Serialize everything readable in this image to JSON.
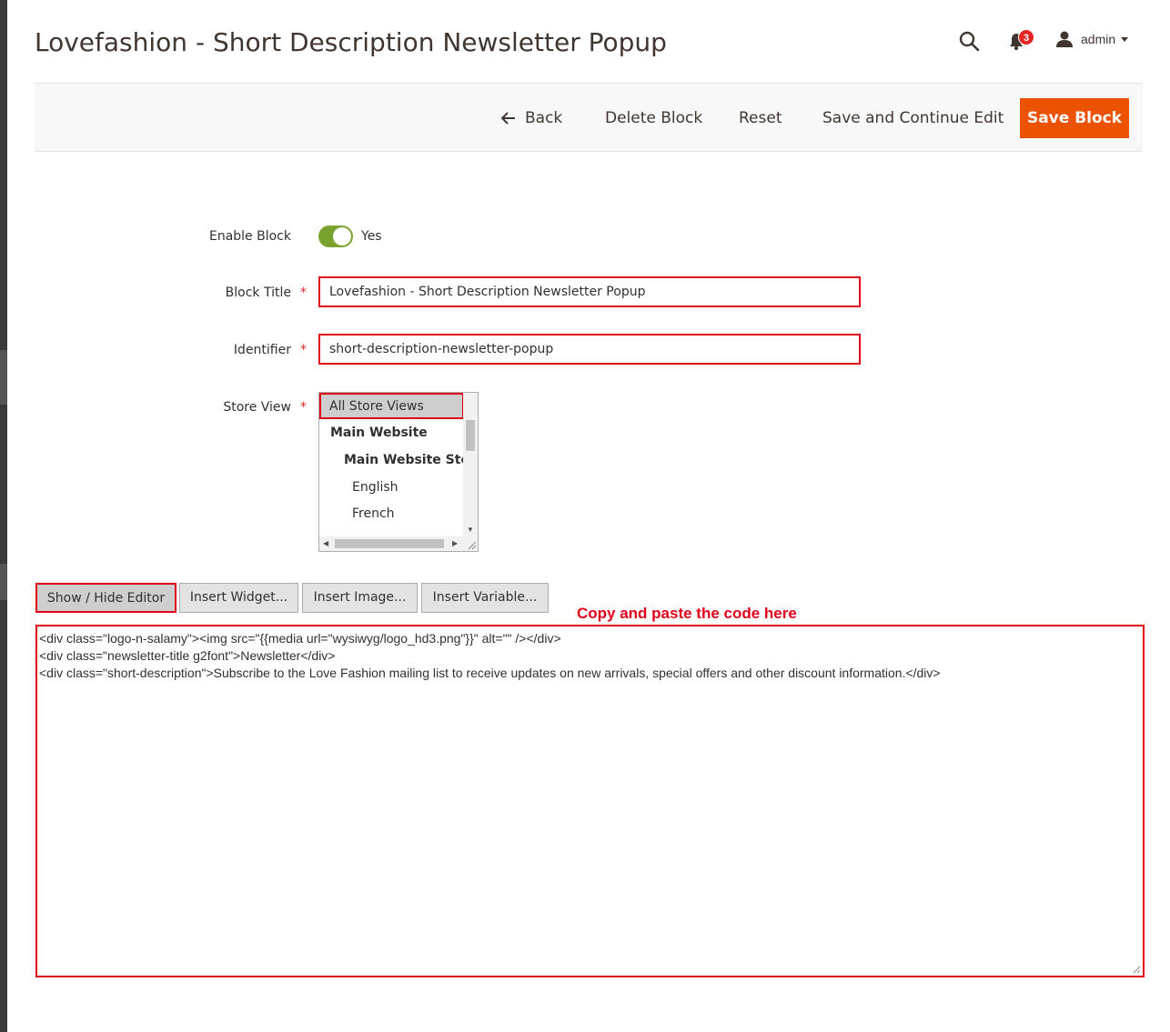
{
  "header": {
    "title": "Lovefashion - Short Description Newsletter Popup",
    "notifications_count": "3",
    "user_name": "admin"
  },
  "toolbar": {
    "back_label": "Back",
    "delete_label": "Delete Block",
    "reset_label": "Reset",
    "save_continue_label": "Save and Continue Edit",
    "save_label": "Save Block"
  },
  "form": {
    "enable_block": {
      "label": "Enable Block",
      "value_label": "Yes",
      "enabled": true
    },
    "block_title": {
      "label": "Block Title",
      "required_mark": "*",
      "value": "Lovefashion - Short Description Newsletter Popup"
    },
    "identifier": {
      "label": "Identifier",
      "required_mark": "*",
      "value": "short-description-newsletter-popup"
    },
    "store_view": {
      "label": "Store View",
      "required_mark": "*",
      "options": [
        {
          "label": "All Store Views",
          "selected": true
        },
        {
          "label": "Main Website"
        },
        {
          "label": "Main Website Store"
        },
        {
          "label": "English"
        },
        {
          "label": "French"
        }
      ]
    }
  },
  "editor": {
    "buttons": [
      "Show / Hide Editor",
      "Insert Widget...",
      "Insert Image...",
      "Insert Variable..."
    ],
    "annotation": "Copy and paste the code here",
    "content_lines": [
      "<div class=\"logo-n-salamy\"><img src=\"{{media url=\"wysiwyg/logo_hd3.png\"}}\" alt=\"\" /></div>",
      "<div class=\"newsletter-title g2font\">Newsletter</div>",
      "<div class=\"short-description\">Subscribe to the Love Fashion mailing list to receive updates on new arrivals, special offers and other discount information.</div>"
    ]
  },
  "colors": {
    "accent": "#eb5202",
    "highlight": "#e1001a",
    "toggle_on": "#79a22e",
    "badge": "#e22626"
  }
}
